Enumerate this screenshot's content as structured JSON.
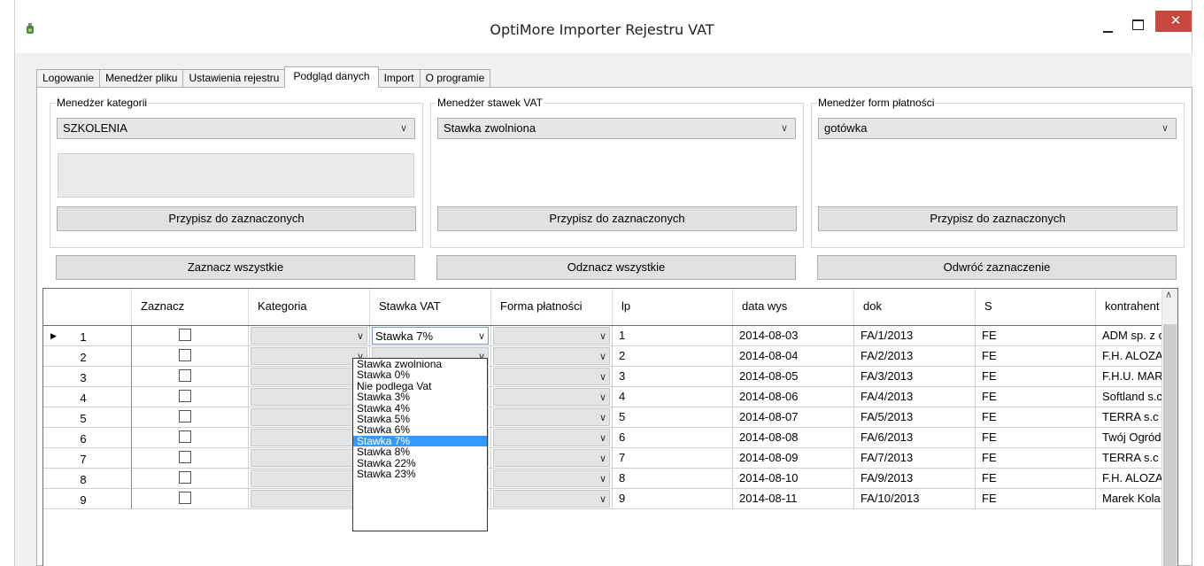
{
  "window": {
    "title": "OptiMore Importer Rejestru VAT",
    "close_glyph": "✕"
  },
  "tabs": [
    {
      "label": "Logowanie"
    },
    {
      "label": "Menedżer pliku"
    },
    {
      "label": "Ustawienia rejestru"
    },
    {
      "label": "Podgląd danych"
    },
    {
      "label": "Import"
    },
    {
      "label": "O programie"
    }
  ],
  "active_tab": "Podgląd danych",
  "groups": {
    "kategorie": {
      "legend": "Menedżer kategorii",
      "selected": "SZKOLENIA",
      "button": "Przypisz do zaznaczonych"
    },
    "stawki": {
      "legend": "Menedżer stawek VAT",
      "selected": "Stawka zwolniona",
      "button": "Przypisz do zaznaczonych"
    },
    "platnosci": {
      "legend": "Menedżer form płatności",
      "selected": "gotówka",
      "button": "Przypisz do zaznaczonych"
    }
  },
  "actions": {
    "select_all": "Zaznacz wszystkie",
    "deselect_all": "Odznacz wszystkie",
    "invert": "Odwróć zaznaczenie"
  },
  "grid": {
    "columns": [
      "Zaznacz",
      "Kategoria",
      "Stawka VAT",
      "Forma płatności",
      "lp",
      "data wys",
      "dok",
      "S",
      "kontrahent"
    ],
    "rows": [
      {
        "n": "1",
        "stawka": "Stawka 7%",
        "lp": "1",
        "data": "2014-08-03",
        "dok": "FA/1/2013",
        "s": "FE",
        "kontrahent": "ADM sp. z o"
      },
      {
        "n": "2",
        "stawka": "",
        "lp": "2",
        "data": "2014-08-04",
        "dok": "FA/2/2013",
        "s": "FE",
        "kontrahent": "F.H. ALOZA"
      },
      {
        "n": "3",
        "stawka": "",
        "lp": "3",
        "data": "2014-08-05",
        "dok": "FA/3/2013",
        "s": "FE",
        "kontrahent": "F.H.U. MAR"
      },
      {
        "n": "4",
        "stawka": "",
        "lp": "4",
        "data": "2014-08-06",
        "dok": "FA/4/2013",
        "s": "FE",
        "kontrahent": "Softland s.c"
      },
      {
        "n": "5",
        "stawka": "",
        "lp": "5",
        "data": "2014-08-07",
        "dok": "FA/5/2013",
        "s": "FE",
        "kontrahent": "TERRA s.c"
      },
      {
        "n": "6",
        "stawka": "",
        "lp": "6",
        "data": "2014-08-08",
        "dok": "FA/6/2013",
        "s": "FE",
        "kontrahent": "Twój Ogród"
      },
      {
        "n": "7",
        "stawka": "",
        "lp": "7",
        "data": "2014-08-09",
        "dok": "FA/7/2013",
        "s": "FE",
        "kontrahent": "TERRA s.c"
      },
      {
        "n": "8",
        "stawka": "",
        "lp": "8",
        "data": "2014-08-10",
        "dok": "FA/9/2013",
        "s": "FE",
        "kontrahent": "F.H. ALOZA"
      },
      {
        "n": "9",
        "stawka": "",
        "lp": "9",
        "data": "2014-08-11",
        "dok": "FA/10/2013",
        "s": "FE",
        "kontrahent": "Marek Kola"
      }
    ]
  },
  "dropdown": {
    "options": [
      "Stawka zwolniona",
      "Stawka 0%",
      "Nie podlega Vat",
      "Stawka 3%",
      "Stawka 4%",
      "Stawka 5%",
      "Stawka 6%",
      "Stawka 7%",
      "Stawka 8%",
      "Stawka 22%",
      "Stawka 23%"
    ],
    "selected": "Stawka 7%"
  },
  "colors": {
    "close": "#c7493f",
    "selection": "#3399ff"
  }
}
